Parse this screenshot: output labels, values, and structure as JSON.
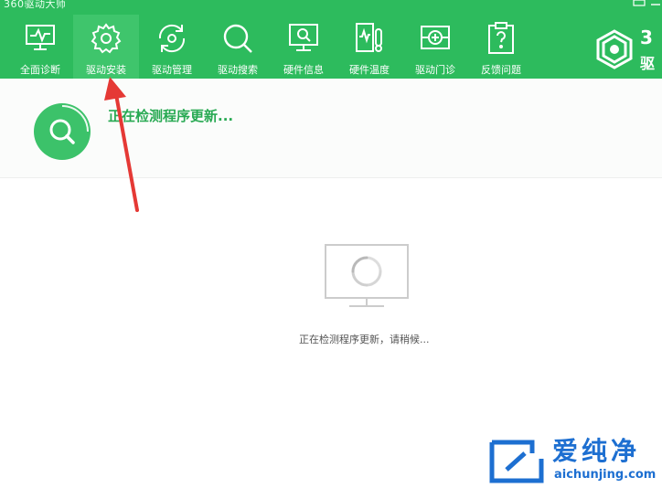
{
  "app": {
    "title": "360驱动大师"
  },
  "nav": [
    {
      "id": "full-diagnosis",
      "label": "全面诊断",
      "icon": "monitor-pulse-icon"
    },
    {
      "id": "driver-install",
      "label": "驱动安装",
      "icon": "gear-icon",
      "active": true
    },
    {
      "id": "driver-manage",
      "label": "驱动管理",
      "icon": "refresh-gear-icon"
    },
    {
      "id": "driver-search",
      "label": "驱动搜索",
      "icon": "search-icon"
    },
    {
      "id": "hardware-info",
      "label": "硬件信息",
      "icon": "monitor-search-icon"
    },
    {
      "id": "hardware-temp",
      "label": "硬件温度",
      "icon": "thermometer-icon"
    },
    {
      "id": "driver-clinic",
      "label": "驱动门诊",
      "icon": "plus-clinic-icon"
    },
    {
      "id": "feedback",
      "label": "反馈问题",
      "icon": "question-clipboard-icon"
    }
  ],
  "brand": {
    "text": "3",
    "sub": "驱"
  },
  "status": {
    "text": "正在检测程序更新..."
  },
  "main": {
    "loading_text": "正在检测程序更新，请稍候..."
  },
  "watermark": {
    "cn": "爱纯净",
    "en": "aichunjing.com"
  },
  "colors": {
    "primary": "#2dbb5d",
    "active": "#3fc56c",
    "status_green": "#27a952",
    "arrow": "#e53935",
    "watermark": "#1d6fd1"
  }
}
